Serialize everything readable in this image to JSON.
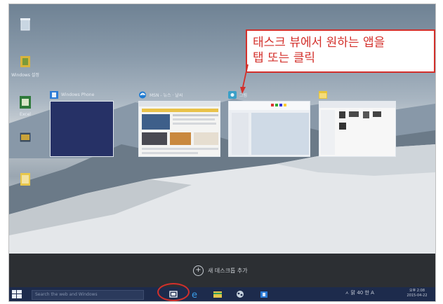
{
  "callout": {
    "line1": "태스크 뷰에서 원하는 앱을",
    "line2": "탭 또는 클릭"
  },
  "task_view": {
    "windows": [
      {
        "title": "Windows Phone"
      },
      {
        "title": "MSN - 뉴스 · 날씨"
      },
      {
        "title": "그림"
      },
      {
        "title": ""
      }
    ],
    "add_desktop_label": "새 데스크톱 추가"
  },
  "desktop": {
    "icons": [
      {
        "label": ""
      },
      {
        "label": "Windows 설정"
      },
      {
        "label": "Excel"
      },
      {
        "label": ""
      },
      {
        "label": ""
      }
    ]
  },
  "taskbar": {
    "search_placeholder": "Search the web and Windows",
    "tray_text": "ㅅ 맑 40 한 A",
    "time": "오후 2:08",
    "date": "2015-04-22"
  },
  "colors": {
    "accent": "#d3302b",
    "taskbar": "#1d2b4c",
    "add_desktop_bar": "#2c2f33"
  }
}
